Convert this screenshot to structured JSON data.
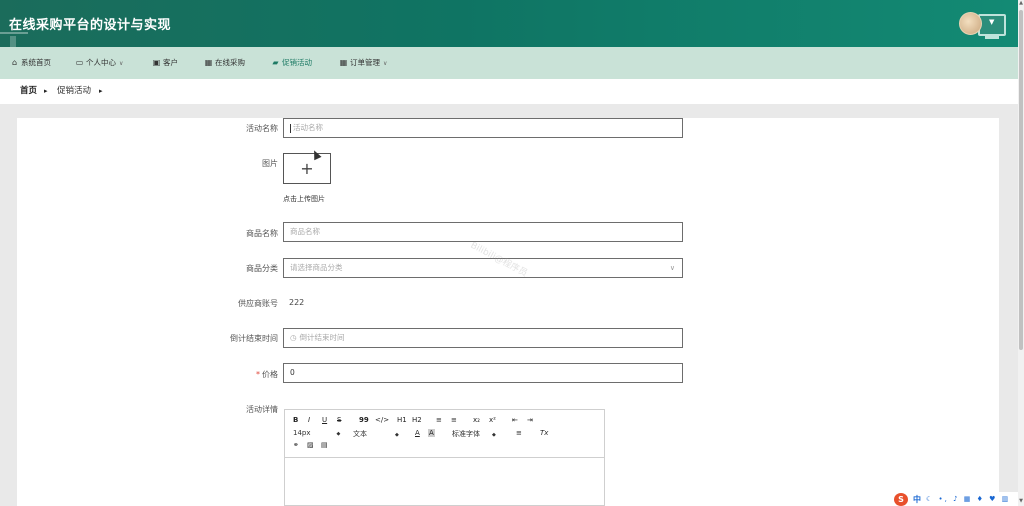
{
  "app": {
    "title": "在线采购平台的设计与实现"
  },
  "nav": {
    "items": [
      {
        "label": "系统首页",
        "icon": "home-icon"
      },
      {
        "label": "个人中心",
        "icon": "user-card-icon",
        "dropdown": true
      },
      {
        "label": "客户",
        "icon": "customer-icon"
      },
      {
        "label": "在线采购",
        "icon": "grid-icon"
      },
      {
        "label": "促销活动",
        "icon": "briefcase-icon",
        "active": true
      },
      {
        "label": "订单管理",
        "icon": "grid-icon",
        "dropdown": true
      }
    ],
    "active_color": "#1d7a64"
  },
  "breadcrumb": {
    "home": "首页",
    "current": "促销活动"
  },
  "form": {
    "activity_name": {
      "label": "活动名称",
      "placeholder": "活动名称",
      "value": ""
    },
    "image": {
      "label": "图片",
      "upload_tip": "点击上传图片"
    },
    "product_name": {
      "label": "商品名称",
      "placeholder": "商品名称",
      "value": ""
    },
    "product_category": {
      "label": "商品分类",
      "placeholder": "请选择商品分类"
    },
    "supplier_account": {
      "label": "供应商账号",
      "value": "222"
    },
    "countdown_end": {
      "label": "倒计结束时间",
      "placeholder": "倒计结束时间"
    },
    "price": {
      "label": "价格",
      "required_mark": "*",
      "value": "0"
    },
    "details": {
      "label": "活动详情"
    }
  },
  "editor": {
    "row1": [
      "B",
      "I",
      "U",
      "S",
      "99",
      "</>",
      "H1",
      "H2",
      "≡",
      "≡",
      "x₂",
      "x²",
      "⇤",
      "⇥"
    ],
    "font_size": "14px",
    "text_type": "文本",
    "font_color": "A",
    "bg_color": "A",
    "font_family": "标准字体",
    "align": "≡",
    "clear_format": "Tx"
  },
  "watermark": "Bilibili@程序员",
  "ime": {
    "lang": "中"
  },
  "colors": {
    "header_bg": "#13735f",
    "nav_bg": "#c9e2d7",
    "required": "#e0463a"
  }
}
